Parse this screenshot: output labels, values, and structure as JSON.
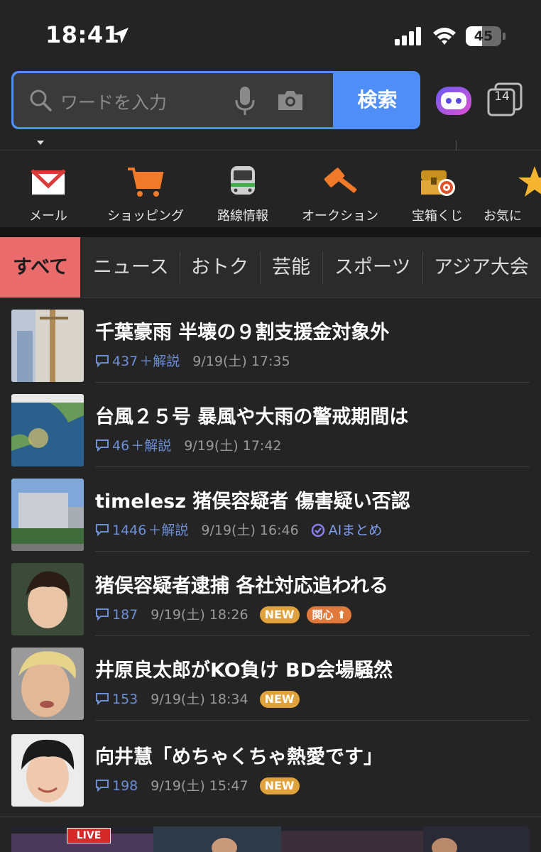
{
  "status_bar": {
    "time": "18:41",
    "battery": "45",
    "battery_level": 0.45
  },
  "search": {
    "placeholder": "ワードを入力",
    "button_label": "検索"
  },
  "tabs_count": "14",
  "quick_links": [
    {
      "label": "メール",
      "icon": "mail-icon"
    },
    {
      "label": "ショッピング",
      "icon": "shopping-cart-icon"
    },
    {
      "label": "路線情報",
      "icon": "train-icon"
    },
    {
      "label": "オークション",
      "icon": "auction-hammer-icon"
    },
    {
      "label": "宝箱くじ",
      "icon": "treasure-chest-icon"
    },
    {
      "label": "お気に",
      "icon": "star-icon"
    }
  ],
  "categories": [
    "すべて",
    "ニュース",
    "おトク",
    "芸能",
    "スポーツ",
    "アジア大会"
  ],
  "news": [
    {
      "headline": "千葉豪雨 半壊の９割支援金対象外",
      "comments": "437",
      "kaisetsu": "＋解説",
      "date": "9/19(土) 17:35"
    },
    {
      "headline": "台風２５号 暴風や大雨の警戒期間は",
      "comments": "46",
      "kaisetsu": "＋解説",
      "date": "9/19(土) 17:42"
    },
    {
      "headline": "timelesz 猪俣容疑者 傷害疑い否認",
      "comments": "1446",
      "kaisetsu": "＋解説",
      "date": "9/19(土) 16:46",
      "ai_label": "AIまとめ"
    },
    {
      "headline": "猪俣容疑者逮捕 各社対応追われる",
      "comments": "187",
      "date": "9/19(土) 18:26",
      "badge": "NEW",
      "badge2": "関心"
    },
    {
      "headline": "井原良太郎がKO負け BD会場騒然",
      "comments": "153",
      "date": "9/19(土) 18:34",
      "badge": "NEW"
    },
    {
      "headline": "向井慧「めちゃくちゃ熱愛です」",
      "comments": "198",
      "date": "9/19(土) 15:47",
      "badge": "NEW"
    }
  ],
  "banner": {
    "live_label": "LIVE"
  },
  "colors": {
    "accent_blue": "#4f8df7",
    "active_tab": "#ea6b6b",
    "new_badge": "#e0a23c",
    "comment_blue": "#6d8fd6"
  }
}
